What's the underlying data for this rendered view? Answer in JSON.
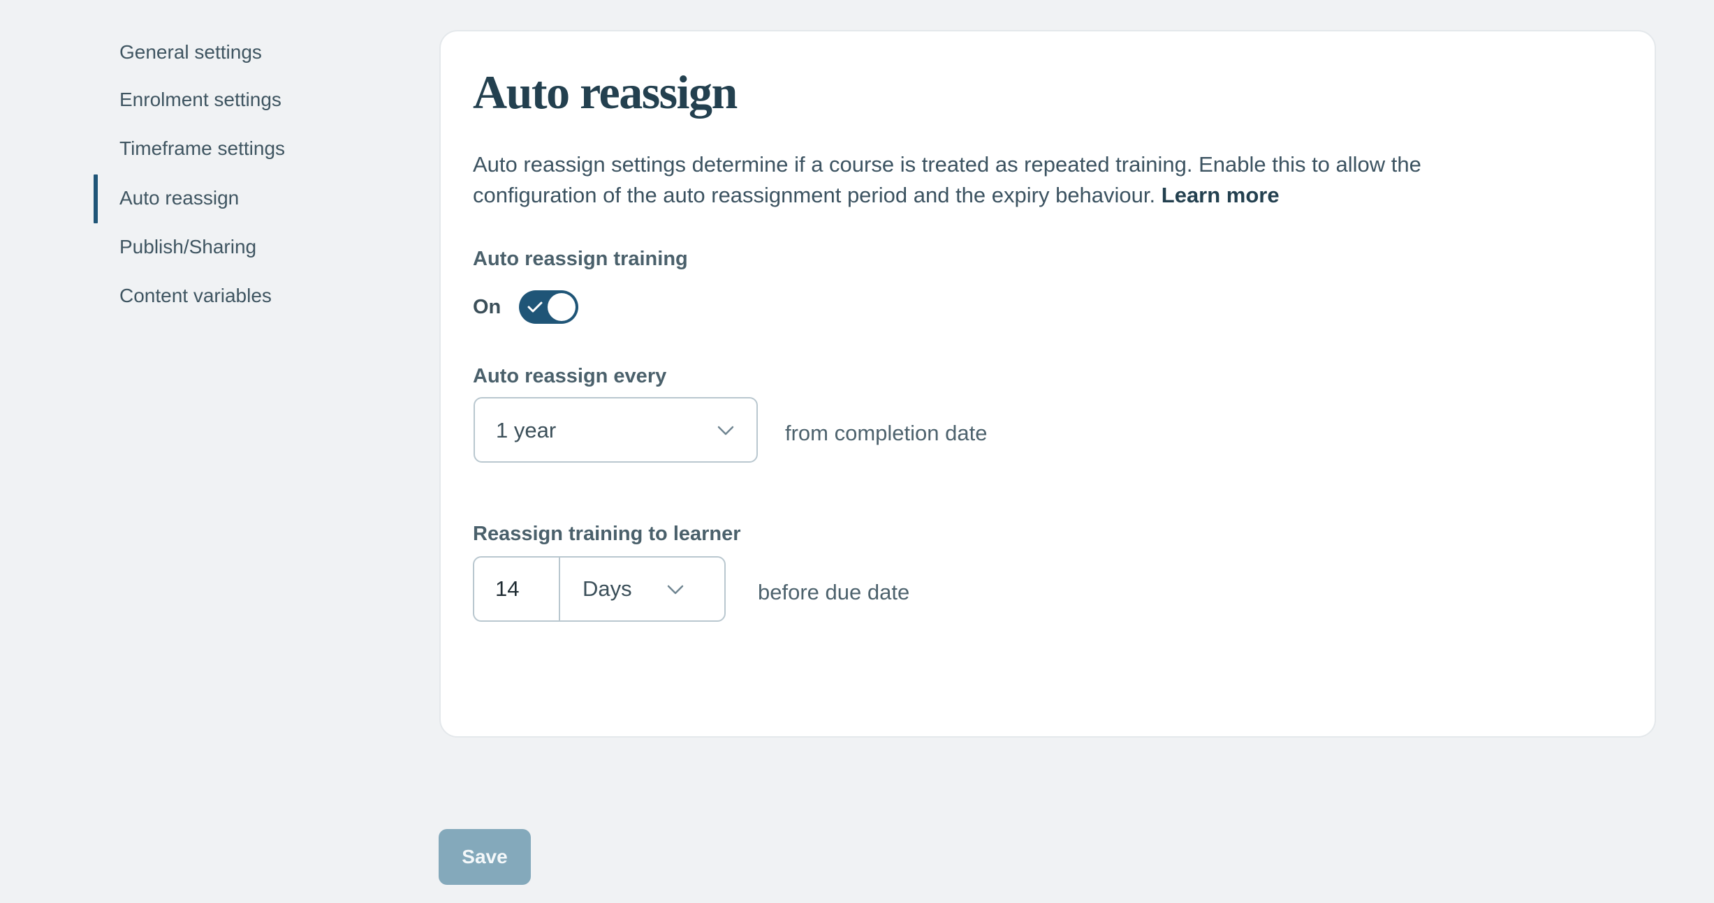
{
  "sidebar": {
    "items": [
      {
        "label": "General settings",
        "active": false
      },
      {
        "label": "Enrolment settings",
        "active": false
      },
      {
        "label": "Timeframe settings",
        "active": false
      },
      {
        "label": "Auto reassign",
        "active": true
      },
      {
        "label": "Publish/Sharing",
        "active": false
      },
      {
        "label": "Content variables",
        "active": false
      }
    ]
  },
  "main": {
    "title": "Auto reassign",
    "description": "Auto reassign settings determine if a course is treated as repeated training. Enable this to allow the configuration of the auto reassignment period and the expiry behaviour.",
    "learn_more": "Learn more",
    "auto_reassign_training": {
      "label": "Auto reassign training",
      "state_text": "On",
      "enabled": true,
      "icon": "check-icon"
    },
    "auto_reassign_every": {
      "label": "Auto reassign every",
      "selected": "1 year",
      "suffix": "from completion date",
      "icon": "chevron-down-icon"
    },
    "reassign_to_learner": {
      "label": "Reassign training to learner",
      "number_value": "14",
      "unit_selected": "Days",
      "suffix": "before due date",
      "icon": "chevron-down-icon"
    }
  },
  "footer": {
    "save_label": "Save"
  },
  "colors": {
    "accent": "#1f5577",
    "save_disabled": "#84a9bb",
    "background": "#f0f2f4"
  }
}
